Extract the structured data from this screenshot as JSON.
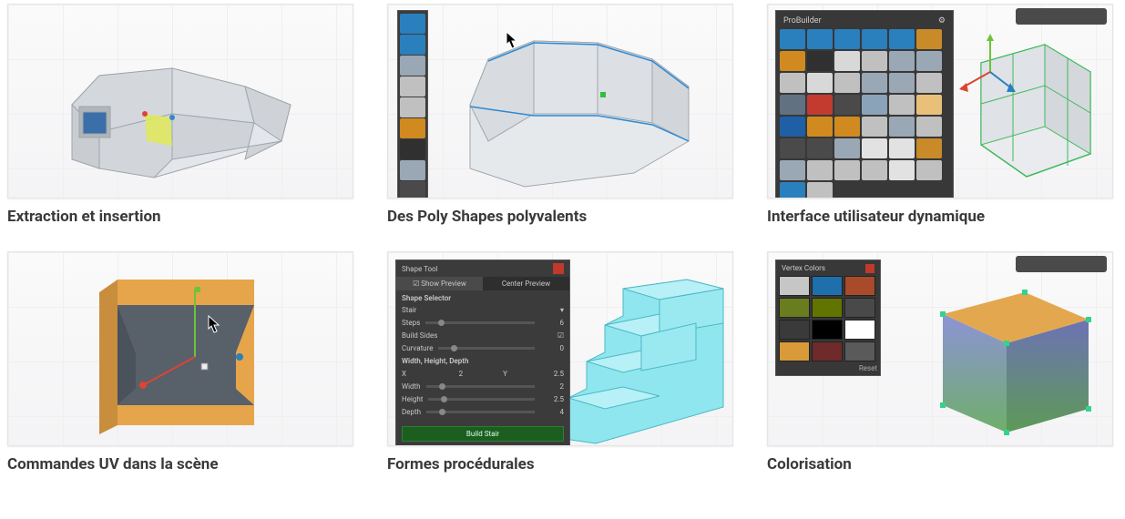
{
  "cards": [
    {
      "caption": "Extraction et insertion"
    },
    {
      "caption": "Des Poly Shapes polyvalents"
    },
    {
      "caption": "Interface utilisateur dynamique"
    },
    {
      "caption": "Commandes UV dans la scène"
    },
    {
      "caption": "Formes procédurales"
    },
    {
      "caption": "Colorisation"
    }
  ],
  "panel3": {
    "title": "ProBuilder",
    "icon_colors": [
      "#2a7fbd",
      "#2a7fbd",
      "#2a7fbd",
      "#2a7fbd",
      "#2a7fbd",
      "#c98a2a",
      "#d08a20",
      "#303030",
      "#d8d8d8",
      "#c0c0c0",
      "#9aa7b4",
      "#9aa7b4",
      "#c0c0c0",
      "#d8d8d8",
      "#c0c0c0",
      "#9aa7b4",
      "#9aa7b4",
      "#c0c0c0",
      "#627182",
      "#c33b2f",
      "#4a4a4a",
      "#8aa3b8",
      "#c0c0c0",
      "#e9c07a",
      "#1e5fa6",
      "#d08a20",
      "#d08a20",
      "#c0c0c0",
      "#9aa7b4",
      "#c0c0c0",
      "#4a4a4a",
      "#4a4a4a",
      "#9aa7b4",
      "#e2e2e2",
      "#e2e2e2",
      "#c98a2a",
      "#9aa7b4",
      "#c0c0c0",
      "#c0c0c0",
      "#c0c0c0",
      "#e2e2e2",
      "#c0c0c0",
      "#2a7fbd",
      "#c0c0c0"
    ]
  },
  "toolbar2_colors": [
    "#2a7fbd",
    "#2a7fbd",
    "#9aa7b4",
    "#c0c0c0",
    "#c0c0c0",
    "#d08a20",
    "#303030",
    "#9aa7b4",
    "#4a4a4a"
  ],
  "shapeTool": {
    "title": "Shape Tool",
    "tabs": {
      "preview": "Show Preview",
      "center": "Center Preview"
    },
    "sectionLabel": "Shape Selector",
    "shapeName": "Stair",
    "rows": {
      "steps": {
        "label": "Steps",
        "value": "6"
      },
      "buildSides": {
        "label": "Build Sides",
        "checked": true
      },
      "curvature": {
        "label": "Curvature",
        "value": "0"
      },
      "whd": {
        "label": "Width, Height, Depth"
      },
      "x": {
        "label": "X",
        "value": "2",
        "ylabel": "Y",
        "yvalue": "2.5"
      },
      "width": {
        "label": "Width",
        "value": "2"
      },
      "height": {
        "label": "Height",
        "value": "2.5"
      },
      "depth": {
        "label": "Depth",
        "value": "4"
      }
    },
    "button": "Build Stair"
  },
  "vertexColors": {
    "title": "Vertex Colors",
    "swatches": [
      "#c6c6c6",
      "#1f6fad",
      "#a94a2a",
      "#6a7d1e",
      "#627400",
      "#494949",
      "#3a3a3a",
      "#000000",
      "#ffffff",
      "#d99a3a",
      "#6f2a2a",
      "#5a5a5a"
    ],
    "reset": "Reset"
  }
}
